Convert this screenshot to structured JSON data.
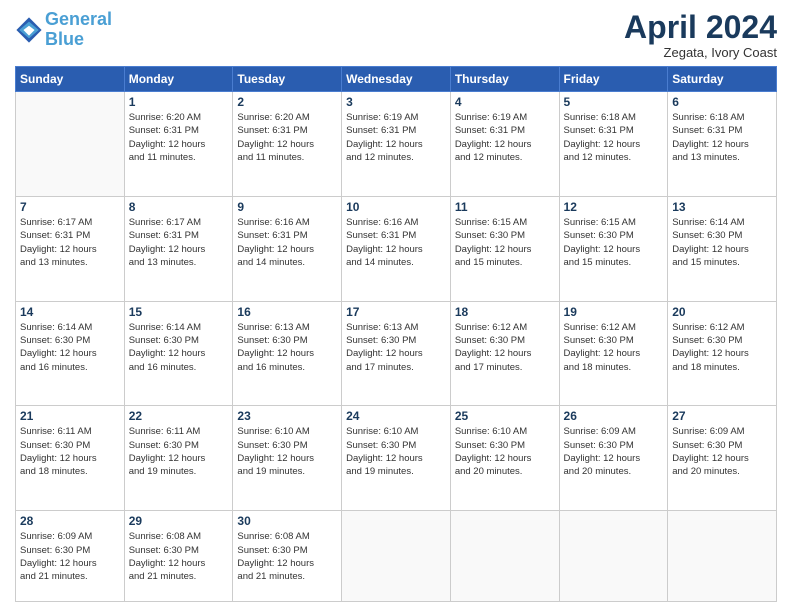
{
  "header": {
    "logo_line1": "General",
    "logo_line2": "Blue",
    "month": "April 2024",
    "location": "Zegata, Ivory Coast"
  },
  "weekdays": [
    "Sunday",
    "Monday",
    "Tuesday",
    "Wednesday",
    "Thursday",
    "Friday",
    "Saturday"
  ],
  "weeks": [
    [
      {
        "day": "",
        "info": ""
      },
      {
        "day": "1",
        "info": "Sunrise: 6:20 AM\nSunset: 6:31 PM\nDaylight: 12 hours\nand 11 minutes."
      },
      {
        "day": "2",
        "info": "Sunrise: 6:20 AM\nSunset: 6:31 PM\nDaylight: 12 hours\nand 11 minutes."
      },
      {
        "day": "3",
        "info": "Sunrise: 6:19 AM\nSunset: 6:31 PM\nDaylight: 12 hours\nand 12 minutes."
      },
      {
        "day": "4",
        "info": "Sunrise: 6:19 AM\nSunset: 6:31 PM\nDaylight: 12 hours\nand 12 minutes."
      },
      {
        "day": "5",
        "info": "Sunrise: 6:18 AM\nSunset: 6:31 PM\nDaylight: 12 hours\nand 12 minutes."
      },
      {
        "day": "6",
        "info": "Sunrise: 6:18 AM\nSunset: 6:31 PM\nDaylight: 12 hours\nand 13 minutes."
      }
    ],
    [
      {
        "day": "7",
        "info": "Sunrise: 6:17 AM\nSunset: 6:31 PM\nDaylight: 12 hours\nand 13 minutes."
      },
      {
        "day": "8",
        "info": "Sunrise: 6:17 AM\nSunset: 6:31 PM\nDaylight: 12 hours\nand 13 minutes."
      },
      {
        "day": "9",
        "info": "Sunrise: 6:16 AM\nSunset: 6:31 PM\nDaylight: 12 hours\nand 14 minutes."
      },
      {
        "day": "10",
        "info": "Sunrise: 6:16 AM\nSunset: 6:31 PM\nDaylight: 12 hours\nand 14 minutes."
      },
      {
        "day": "11",
        "info": "Sunrise: 6:15 AM\nSunset: 6:30 PM\nDaylight: 12 hours\nand 15 minutes."
      },
      {
        "day": "12",
        "info": "Sunrise: 6:15 AM\nSunset: 6:30 PM\nDaylight: 12 hours\nand 15 minutes."
      },
      {
        "day": "13",
        "info": "Sunrise: 6:14 AM\nSunset: 6:30 PM\nDaylight: 12 hours\nand 15 minutes."
      }
    ],
    [
      {
        "day": "14",
        "info": "Sunrise: 6:14 AM\nSunset: 6:30 PM\nDaylight: 12 hours\nand 16 minutes."
      },
      {
        "day": "15",
        "info": "Sunrise: 6:14 AM\nSunset: 6:30 PM\nDaylight: 12 hours\nand 16 minutes."
      },
      {
        "day": "16",
        "info": "Sunrise: 6:13 AM\nSunset: 6:30 PM\nDaylight: 12 hours\nand 16 minutes."
      },
      {
        "day": "17",
        "info": "Sunrise: 6:13 AM\nSunset: 6:30 PM\nDaylight: 12 hours\nand 17 minutes."
      },
      {
        "day": "18",
        "info": "Sunrise: 6:12 AM\nSunset: 6:30 PM\nDaylight: 12 hours\nand 17 minutes."
      },
      {
        "day": "19",
        "info": "Sunrise: 6:12 AM\nSunset: 6:30 PM\nDaylight: 12 hours\nand 18 minutes."
      },
      {
        "day": "20",
        "info": "Sunrise: 6:12 AM\nSunset: 6:30 PM\nDaylight: 12 hours\nand 18 minutes."
      }
    ],
    [
      {
        "day": "21",
        "info": "Sunrise: 6:11 AM\nSunset: 6:30 PM\nDaylight: 12 hours\nand 18 minutes."
      },
      {
        "day": "22",
        "info": "Sunrise: 6:11 AM\nSunset: 6:30 PM\nDaylight: 12 hours\nand 19 minutes."
      },
      {
        "day": "23",
        "info": "Sunrise: 6:10 AM\nSunset: 6:30 PM\nDaylight: 12 hours\nand 19 minutes."
      },
      {
        "day": "24",
        "info": "Sunrise: 6:10 AM\nSunset: 6:30 PM\nDaylight: 12 hours\nand 19 minutes."
      },
      {
        "day": "25",
        "info": "Sunrise: 6:10 AM\nSunset: 6:30 PM\nDaylight: 12 hours\nand 20 minutes."
      },
      {
        "day": "26",
        "info": "Sunrise: 6:09 AM\nSunset: 6:30 PM\nDaylight: 12 hours\nand 20 minutes."
      },
      {
        "day": "27",
        "info": "Sunrise: 6:09 AM\nSunset: 6:30 PM\nDaylight: 12 hours\nand 20 minutes."
      }
    ],
    [
      {
        "day": "28",
        "info": "Sunrise: 6:09 AM\nSunset: 6:30 PM\nDaylight: 12 hours\nand 21 minutes."
      },
      {
        "day": "29",
        "info": "Sunrise: 6:08 AM\nSunset: 6:30 PM\nDaylight: 12 hours\nand 21 minutes."
      },
      {
        "day": "30",
        "info": "Sunrise: 6:08 AM\nSunset: 6:30 PM\nDaylight: 12 hours\nand 21 minutes."
      },
      {
        "day": "",
        "info": ""
      },
      {
        "day": "",
        "info": ""
      },
      {
        "day": "",
        "info": ""
      },
      {
        "day": "",
        "info": ""
      }
    ]
  ]
}
